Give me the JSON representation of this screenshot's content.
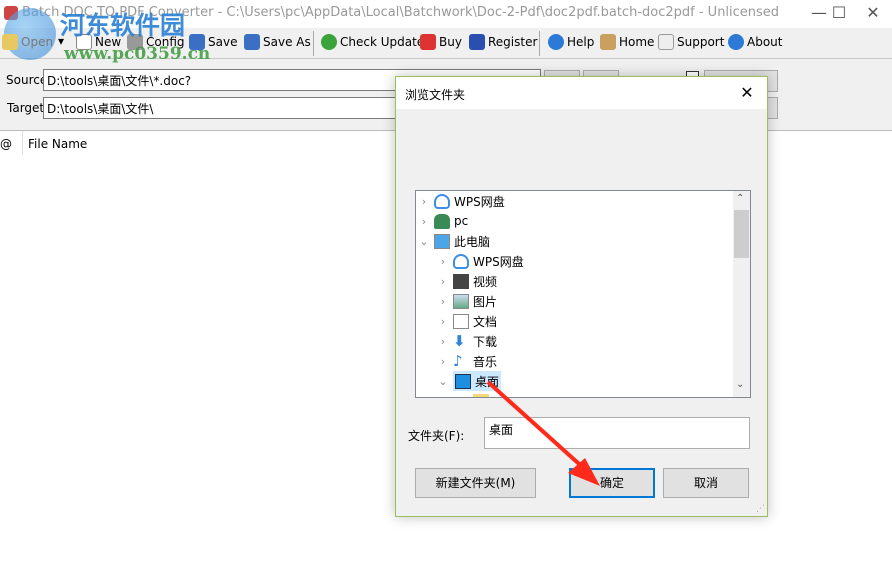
{
  "window": {
    "title": "Batch DOC TO PDF Converter - C:\\Users\\pc\\AppData\\Local\\Batchwork\\Doc-2-Pdf\\doc2pdf.batch-doc2pdf - Unlicensed"
  },
  "watermark": {
    "name": "河东软件园",
    "url": "www.pc0359.cn"
  },
  "toolbar": {
    "items": [
      {
        "label": "Open",
        "icon": "folder-open-icon"
      },
      {
        "label": "New",
        "icon": "new-file-icon"
      },
      {
        "label": "Config",
        "icon": "tools-icon"
      },
      {
        "label": "Save",
        "icon": "save-icon"
      },
      {
        "label": "Save As",
        "icon": "save-as-icon"
      },
      {
        "label": "Check Update",
        "icon": "refresh-icon"
      },
      {
        "label": "Buy",
        "icon": "cart-icon"
      },
      {
        "label": "Register",
        "icon": "user-icon"
      },
      {
        "label": "Help",
        "icon": "help-icon"
      },
      {
        "label": "Home",
        "icon": "home-icon"
      },
      {
        "label": "Support",
        "icon": "mail-icon"
      },
      {
        "label": "About",
        "icon": "info-icon"
      }
    ]
  },
  "form": {
    "source_label": "Source",
    "source_value": "D:\\tools\\桌面\\文件\\*.doc?",
    "target_label": "Target",
    "target_value": "D:\\tools\\桌面\\文件\\"
  },
  "list": {
    "col_at": "@",
    "col_filename": "File Name"
  },
  "dialog": {
    "title": "浏览文件夹",
    "tree": [
      {
        "label": "WPS网盘",
        "icon": "cloud-icon",
        "level": 0,
        "expanded": false
      },
      {
        "label": "pc",
        "icon": "user-icon",
        "level": 0,
        "expanded": false
      },
      {
        "label": "此电脑",
        "icon": "computer-icon",
        "level": 0,
        "expanded": true
      },
      {
        "label": "WPS网盘",
        "icon": "cloud-icon",
        "level": 1,
        "expanded": false
      },
      {
        "label": "视频",
        "icon": "video-icon",
        "level": 1,
        "expanded": false
      },
      {
        "label": "图片",
        "icon": "picture-icon",
        "level": 1,
        "expanded": false
      },
      {
        "label": "文档",
        "icon": "document-icon",
        "level": 1,
        "expanded": false
      },
      {
        "label": "下载",
        "icon": "download-icon",
        "level": 1,
        "expanded": false
      },
      {
        "label": "音乐",
        "icon": "music-icon",
        "level": 1,
        "expanded": false
      },
      {
        "label": "桌面",
        "icon": "desktop-icon",
        "level": 1,
        "expanded": true,
        "selected": true
      }
    ],
    "folder_label": "文件夹(F):",
    "folder_value": "桌面",
    "new_folder": "新建文件夹(M)",
    "ok": "确定",
    "cancel": "取消"
  },
  "colors": {
    "accent": "#0078d7",
    "selection": "#cce8ff",
    "annotation_arrow": "#ff2a1a"
  }
}
